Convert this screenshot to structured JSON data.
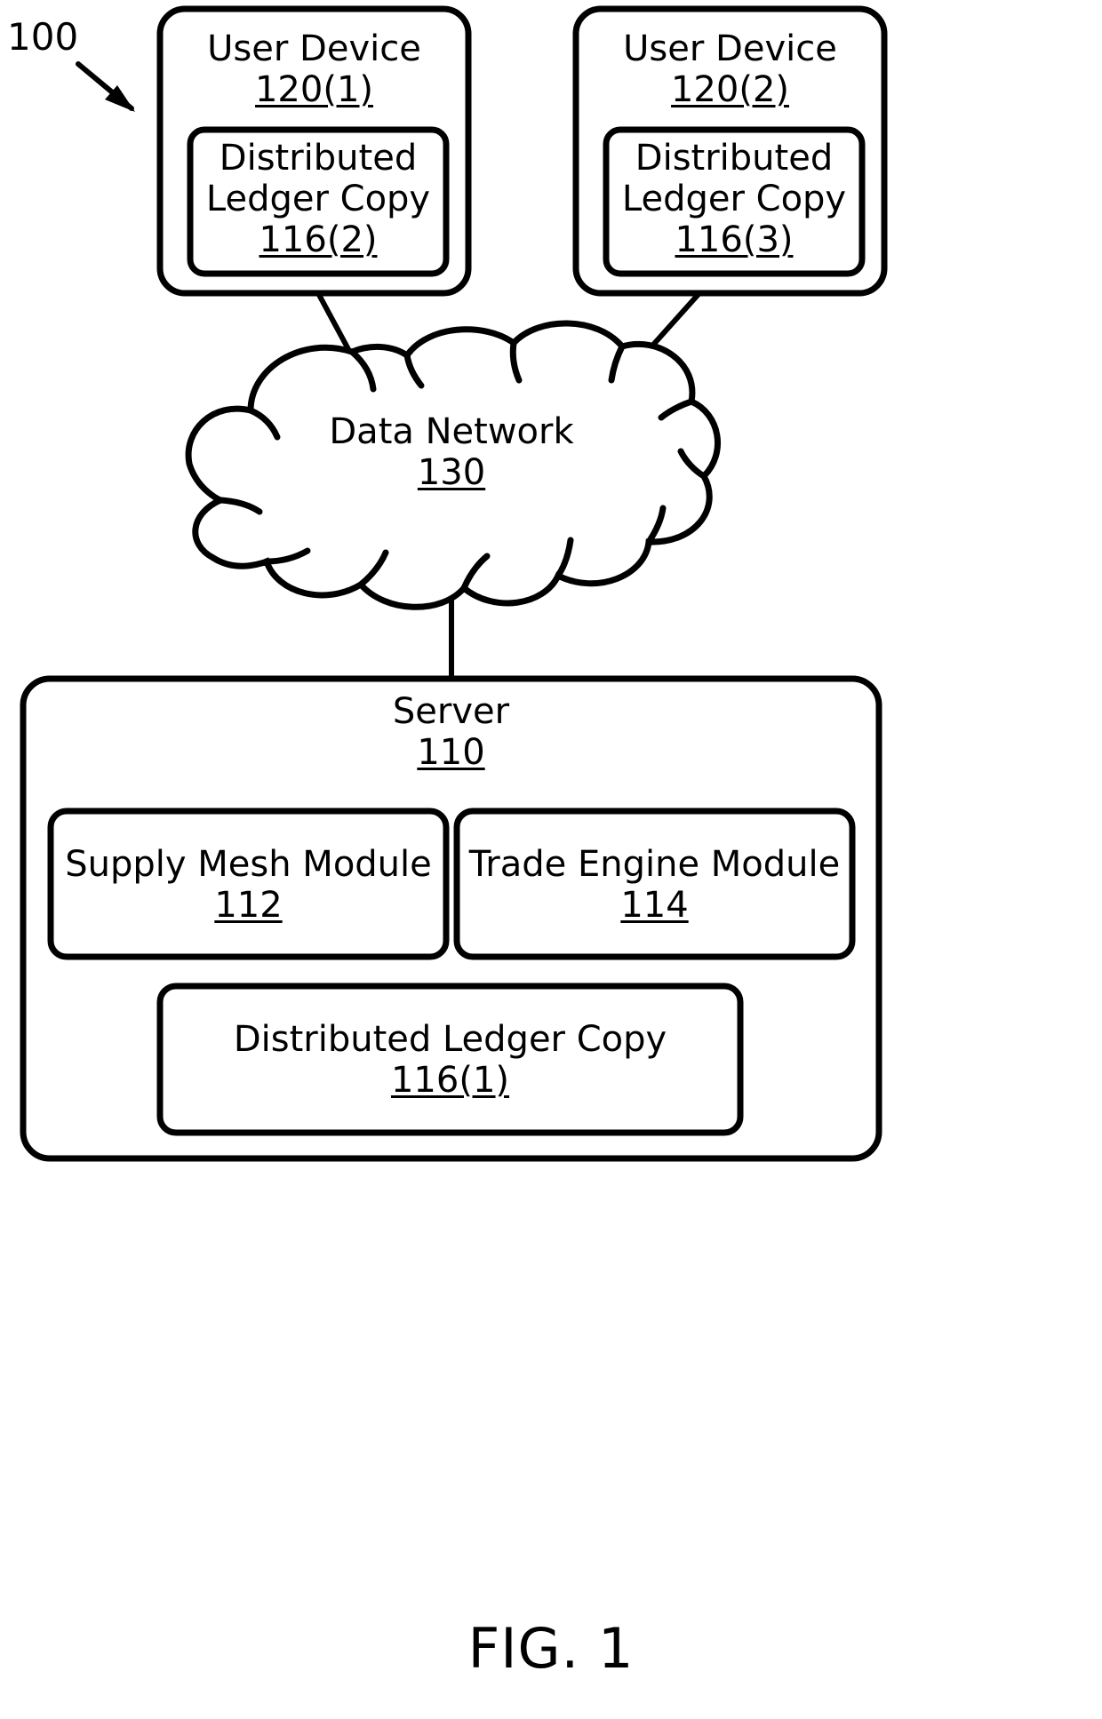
{
  "figure": {
    "caption": "FIG. 1",
    "system_label": "100"
  },
  "user_devices": [
    {
      "title": "User Device",
      "ref": "120(1)",
      "ledger": {
        "title_line1": "Distributed",
        "title_line2": "Ledger Copy",
        "ref": "116(2)"
      }
    },
    {
      "title": "User Device",
      "ref": "120(2)",
      "ledger": {
        "title_line1": "Distributed",
        "title_line2": "Ledger Copy",
        "ref": "116(3)"
      }
    }
  ],
  "network": {
    "title": "Data Network",
    "ref": "130"
  },
  "server": {
    "title": "Server",
    "ref": "110",
    "modules": [
      {
        "title": "Supply Mesh Module",
        "ref": "112"
      },
      {
        "title": "Trade Engine Module",
        "ref": "114"
      }
    ],
    "ledger": {
      "title": "Distributed Ledger Copy",
      "ref": "116(1)"
    }
  },
  "colors": {
    "stroke": "#000000",
    "background": "#ffffff"
  }
}
